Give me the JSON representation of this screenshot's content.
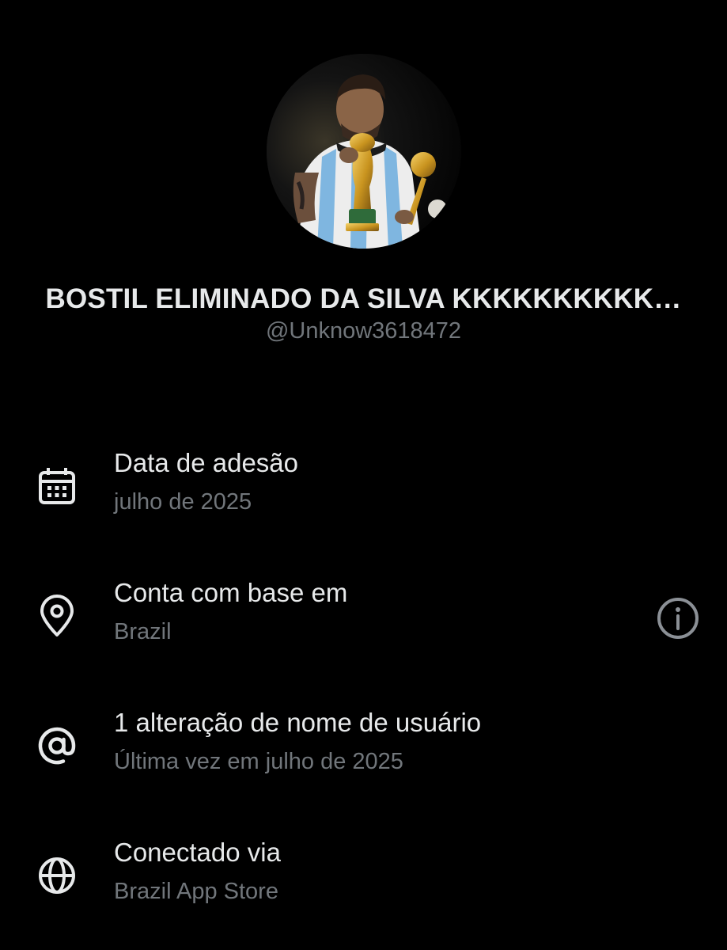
{
  "profile": {
    "avatar_icon": "profile-photo-player-kissing-trophy",
    "display_name": "BOSTIL ELIMINADO DA SILVA KKKKKKKKKK…",
    "handle": "@Unknow3618472"
  },
  "details": [
    {
      "icon": "calendar-icon",
      "title": "Data de adesão",
      "value": "julho de 2025"
    },
    {
      "icon": "location-pin-icon",
      "title": "Conta com base em",
      "value": "Brazil",
      "action_icon": "info-icon"
    },
    {
      "icon": "at-sign-icon",
      "title": "1 alteração de nome de usuário",
      "value": "Última vez em julho de 2025"
    },
    {
      "icon": "globe-icon",
      "title": "Conectado via",
      "value": "Brazil App Store"
    }
  ],
  "colors": {
    "background": "#000000",
    "primary_text": "#e7e9ea",
    "secondary_text": "#71767b"
  }
}
